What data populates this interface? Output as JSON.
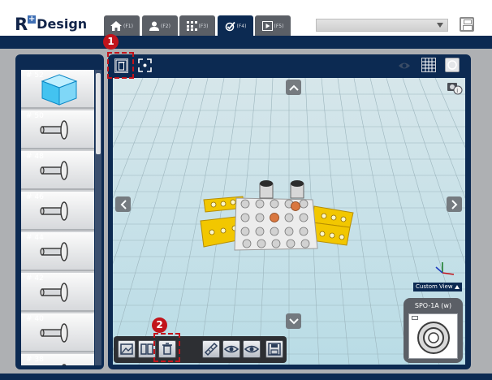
{
  "app": {
    "logo_r": "R",
    "logo_plus": "+",
    "logo_design": "Design"
  },
  "tabs": [
    {
      "key": "(F1)",
      "icon": "home-icon"
    },
    {
      "key": "(F2)",
      "icon": "user-icon"
    },
    {
      "key": "(F3)",
      "icon": "grid-dots-icon"
    },
    {
      "key": "(F4)",
      "icon": "check-gear-icon",
      "active": true
    },
    {
      "key": "(F5)",
      "icon": "play-icon"
    }
  ],
  "model_select": {
    "value": ""
  },
  "parts_list": {
    "items": [
      {
        "number": "# 52",
        "icon": "cube-part-icon"
      },
      {
        "number": "# 50",
        "icon": "rivet-part-icon"
      },
      {
        "number": "# 48",
        "icon": "rivet-part-icon"
      },
      {
        "number": "# 46",
        "icon": "rivet-part-icon"
      },
      {
        "number": "# 44",
        "icon": "rivet-part-icon"
      },
      {
        "number": "# 42",
        "icon": "rivet-part-icon"
      },
      {
        "number": "# 40",
        "icon": "rivet-part-icon"
      },
      {
        "number": "# 38",
        "icon": "rivet-part-icon"
      }
    ]
  },
  "callouts": {
    "first": "1",
    "second": "2"
  },
  "view": {
    "custom_view_label": "Custom View",
    "selected_part_label": "SPO-1A (w)"
  },
  "colors": {
    "navy": "#0c2a52",
    "callout_red": "#c2141b",
    "grid_floor": "#c4e3ea",
    "part_yellow": "#f2c700",
    "part_orange": "#d9773f"
  }
}
